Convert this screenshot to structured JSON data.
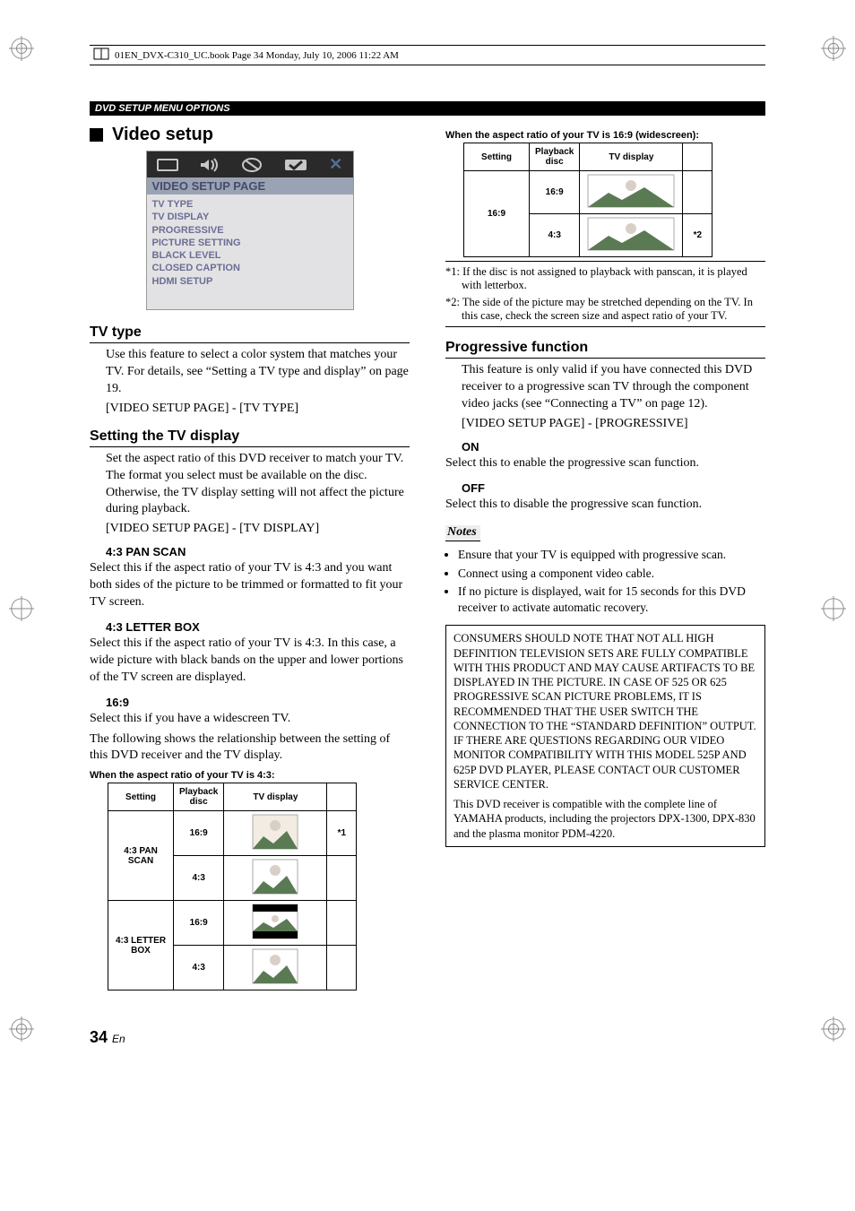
{
  "header_running": "01EN_DVX-C310_UC.book  Page 34  Monday, July 10, 2006  11:22 AM",
  "black_bar": "DVD SETUP MENU OPTIONS",
  "h2_video_setup": "Video setup",
  "osd": {
    "title": "VIDEO SETUP PAGE",
    "items": [
      "TV TYPE",
      "TV DISPLAY",
      "PROGRESSIVE",
      "PICTURE SETTING",
      "BLACK LEVEL",
      "CLOSED CAPTION",
      "HDMI SETUP"
    ]
  },
  "tv_type": {
    "heading": "TV type",
    "body": "Use this feature to select a color system that matches your TV. For details, see “Setting a TV type and display” on page 19.",
    "path": "[VIDEO SETUP PAGE] - [TV TYPE]"
  },
  "setting_tv_display": {
    "heading": "Setting the TV display",
    "body": "Set the aspect ratio of this DVD receiver to match your TV. The format you select must be available on the disc. Otherwise, the TV display setting will not affect the picture during playback.",
    "path": "[VIDEO SETUP PAGE] - [TV DISPLAY]",
    "opt1_h": "4:3 PAN SCAN",
    "opt1_t": "Select this if the aspect ratio of your TV is 4:3 and you want both sides of the picture to be trimmed or formatted to fit your TV screen.",
    "opt2_h": "4:3 LETTER BOX",
    "opt2_t": "Select this if the aspect ratio of your TV is 4:3. In this case, a wide picture with black bands on the upper and lower portions of the TV screen are displayed.",
    "opt3_h": "16:9",
    "opt3_t1": "Select this if you have a widescreen TV.",
    "opt3_t2": "The following shows the relationship between the setting of this DVD receiver and the TV display."
  },
  "table1": {
    "caption": "When the aspect ratio of your TV is 4:3:",
    "headers": {
      "setting": "Setting",
      "disc": "Playback disc",
      "display": "TV display",
      "note": ""
    },
    "rows": [
      {
        "setting": "4:3 PAN SCAN",
        "disc": "16:9",
        "note": "*1"
      },
      {
        "setting": "4:3 PAN SCAN",
        "disc": "4:3",
        "note": ""
      },
      {
        "setting": "4:3 LETTER BOX",
        "disc": "16:9",
        "note": ""
      },
      {
        "setting": "4:3 LETTER BOX",
        "disc": "4:3",
        "note": ""
      }
    ]
  },
  "table2": {
    "caption": "When the aspect ratio of your TV is 16:9 (widescreen):",
    "headers": {
      "setting": "Setting",
      "disc": "Playback disc",
      "display": "TV display",
      "note": ""
    },
    "rows": [
      {
        "setting": "16:9",
        "disc": "16:9",
        "note": ""
      },
      {
        "setting": "16:9",
        "disc": "4:3",
        "note": "*2"
      }
    ]
  },
  "footnotes": {
    "f1": "*1: If the disc is not assigned to playback with panscan, it is played with letterbox.",
    "f2": "*2: The side of the picture may be stretched depending on the TV. In this case, check the screen size and aspect ratio of your TV."
  },
  "progressive": {
    "heading": "Progressive function",
    "body": "This feature is only valid if you have connected this DVD receiver to a progressive scan TV through the component video jacks (see “Connecting a TV” on page 12).",
    "path": "[VIDEO SETUP PAGE] - [PROGRESSIVE]",
    "on_h": "ON",
    "on_t": "Select this to enable the progressive scan function.",
    "off_h": "OFF",
    "off_t": "Select this to disable the progressive scan function."
  },
  "notes": {
    "label": "Notes",
    "items": [
      "Ensure that your TV is equipped with progressive scan.",
      "Connect using a component video cable.",
      "If no picture is displayed, wait for 15 seconds for this DVD receiver to activate automatic recovery."
    ]
  },
  "warning": {
    "p1": "CONSUMERS SHOULD NOTE THAT NOT ALL HIGH DEFINITION TELEVISION SETS ARE FULLY COMPATIBLE WITH THIS PRODUCT AND MAY CAUSE ARTIFACTS TO BE DISPLAYED IN THE PICTURE. IN CASE OF 525 OR 625 PROGRESSIVE SCAN PICTURE PROBLEMS, IT IS RECOMMENDED THAT THE USER SWITCH THE CONNECTION TO THE “STANDARD DEFINITION” OUTPUT. IF THERE ARE QUESTIONS REGARDING OUR VIDEO MONITOR COMPATIBILITY WITH THIS MODEL 525P AND 625P DVD PLAYER, PLEASE CONTACT OUR CUSTOMER SERVICE CENTER.",
    "p2": "This DVD receiver is compatible with the complete line of YAMAHA products, including the projectors DPX-1300, DPX-830 and the plasma monitor PDM-4220."
  },
  "page_number": "34",
  "page_lang": "En"
}
